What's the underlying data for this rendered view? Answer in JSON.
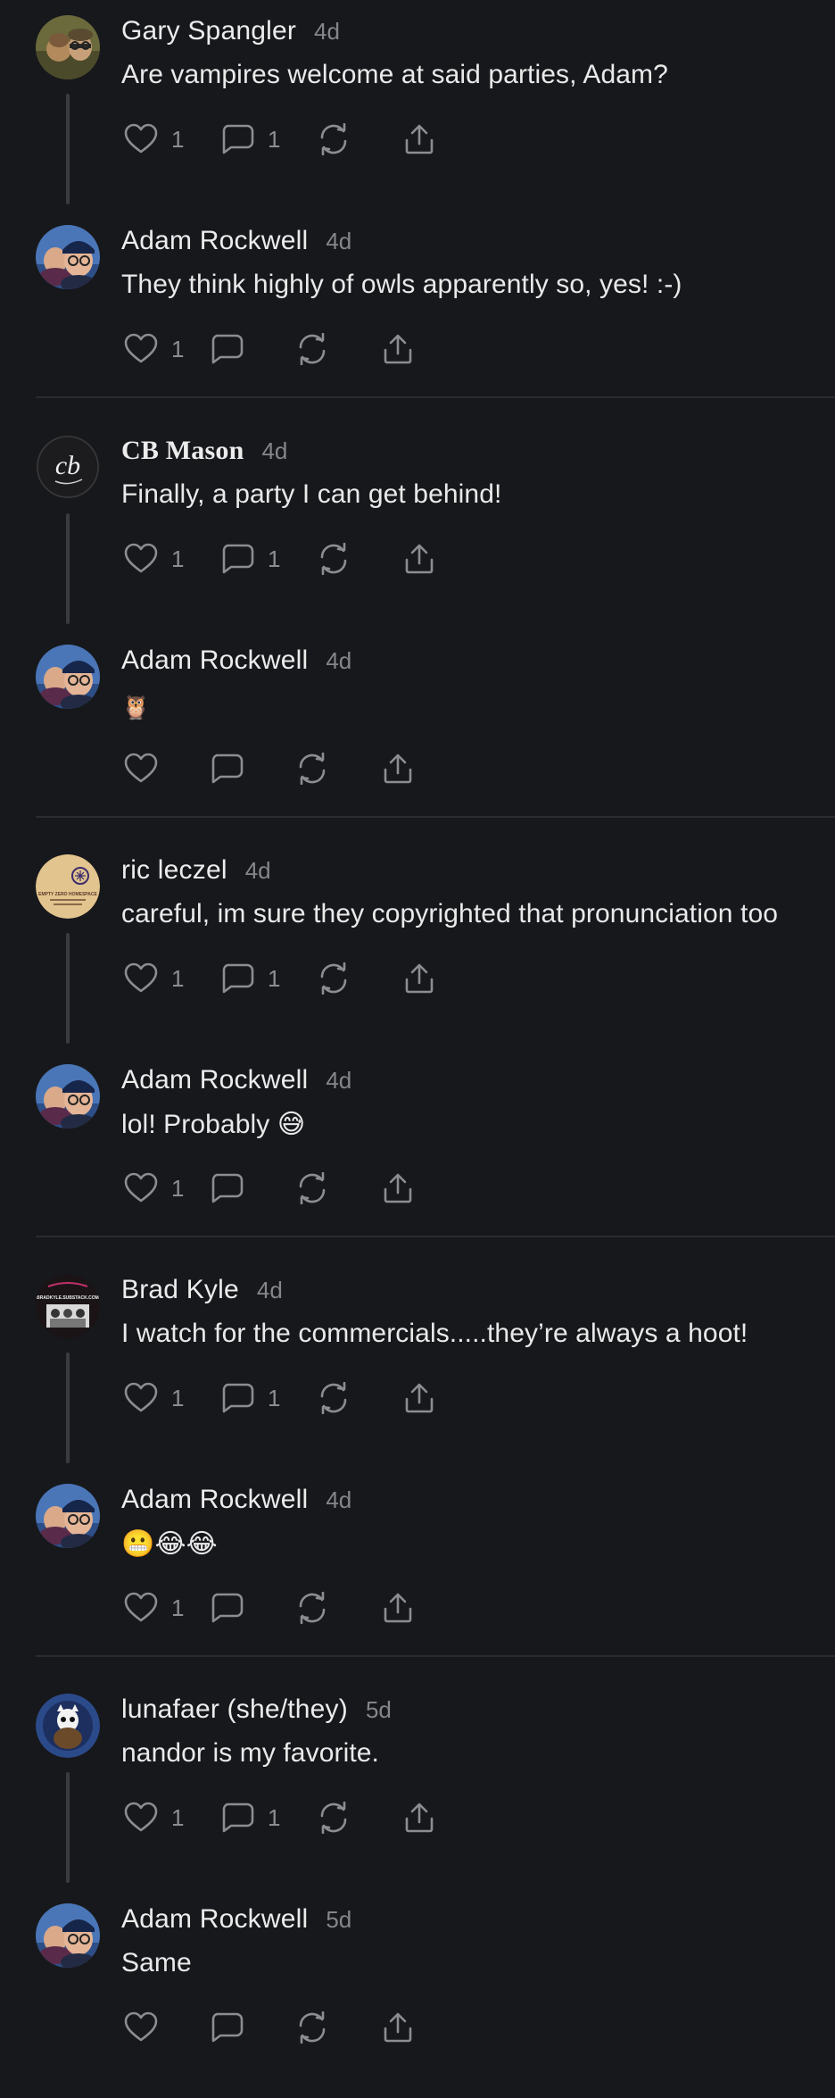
{
  "threads": [
    {
      "parent": {
        "author": "Gary Spangler",
        "time": "4d",
        "text": "Are vampires welcome at said parties, Adam?",
        "likes": "1",
        "replies": "1"
      },
      "reply": {
        "author": "Adam Rockwell",
        "time": "4d",
        "text": "They think highly of owls apparently so, yes! :-)",
        "likes": "1",
        "replies": ""
      }
    },
    {
      "parent": {
        "author": "CB Mason",
        "time": "4d",
        "text": "Finally, a party I can get behind!",
        "likes": "1",
        "replies": "1"
      },
      "reply": {
        "author": "Adam Rockwell",
        "time": "4d",
        "text": "🦉",
        "likes": "",
        "replies": ""
      }
    },
    {
      "parent": {
        "author": "ric leczel",
        "time": "4d",
        "text": "careful, im sure they copyrighted that pronunciation too",
        "likes": "1",
        "replies": "1"
      },
      "reply": {
        "author": "Adam Rockwell",
        "time": "4d",
        "text": "lol! Probably 😅",
        "likes": "1",
        "replies": ""
      }
    },
    {
      "parent": {
        "author": "Brad Kyle",
        "time": "4d",
        "text": "I watch for the commercials.....they’re always a hoot!",
        "likes": "1",
        "replies": "1"
      },
      "reply": {
        "author": "Adam Rockwell",
        "time": "4d",
        "text": "😬😂😂",
        "likes": "1",
        "replies": ""
      }
    },
    {
      "parent": {
        "author": "lunafaer (she/they)",
        "time": "5d",
        "text": "nandor is my favorite.",
        "likes": "1",
        "replies": "1"
      },
      "reply": {
        "author": "Adam Rockwell",
        "time": "5d",
        "text": "Same",
        "likes": "",
        "replies": ""
      }
    }
  ],
  "avatar_logo_text": {
    "cb_mason": "cb",
    "ric_leczel": "EMPTY ZERO HOMESPACE",
    "brad_kyle": "BRADKYLE.SUBSTACK.COM"
  },
  "colors": {
    "background": "#17181b",
    "text": "#e9e9ea",
    "muted": "#85868b",
    "divider": "#2b2c30",
    "icon": "#8c8d92"
  },
  "icons": {
    "like": "heart-icon",
    "reply": "speech-bubble-icon",
    "restack": "restack-icon",
    "share": "share-icon"
  }
}
